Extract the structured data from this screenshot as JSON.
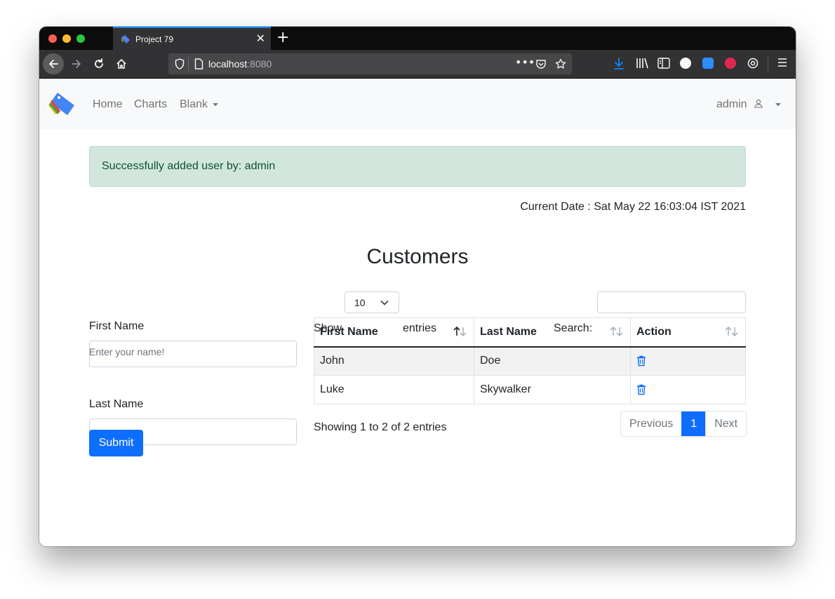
{
  "browser": {
    "tab_title": "Project 79",
    "url_host": "localhost",
    "url_port": ":8080",
    "accent_color": "#0a84ff"
  },
  "site_nav": {
    "links": [
      "Home",
      "Charts",
      "Blank"
    ],
    "user": "admin"
  },
  "alert": {
    "message": "Successfully added user by: admin"
  },
  "current_date": "Current Date : Sat May 22 16:03:04 IST 2021",
  "page_title": "Customers",
  "form": {
    "first_name_label": "First Name",
    "first_name_help": "Enter your name!",
    "last_name_label": "Last Name",
    "submit_label": "Submit"
  },
  "datatable": {
    "show_label": "Show",
    "page_length": "10",
    "entries_label": "entries",
    "search_label": "Search:",
    "columns": [
      "First Name",
      "Last Name",
      "Action"
    ],
    "rows": [
      {
        "first": "John",
        "last": "Doe",
        "action": "trash-icon"
      },
      {
        "first": "Luke",
        "last": "Skywalker",
        "action": "trash-icon"
      }
    ],
    "info": "Showing 1 to 2 of 2 entries",
    "pagination": {
      "previous": "Previous",
      "current": "1",
      "next": "Next"
    }
  }
}
